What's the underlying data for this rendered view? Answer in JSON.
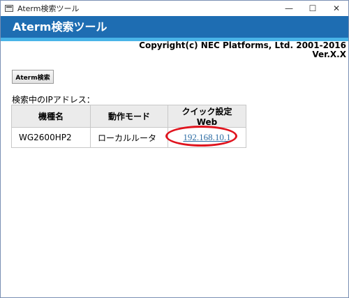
{
  "window": {
    "title": "Aterm検索ツール",
    "controls": {
      "minimize": "—",
      "maximize": "☐",
      "close": "✕"
    }
  },
  "header": {
    "title": "Aterm検索ツール",
    "colors": {
      "bar": "#1e6db2",
      "stripe": "#49b4e8"
    }
  },
  "info": {
    "copyright": "Copyright(c) NEC Platforms, Ltd. 2001-2016",
    "version": "Ver.X.X"
  },
  "toolbar": {
    "search_label": "Aterm検索"
  },
  "results": {
    "label": "検索中のIPアドレス：",
    "columns": [
      "機種名",
      "動作モード",
      "クイック設定Web"
    ],
    "rows": [
      {
        "model": "WG2600HP2",
        "mode": "ローカルルータ",
        "ip": "192.168.10.1"
      }
    ],
    "highlight_color": "#e0141e"
  }
}
